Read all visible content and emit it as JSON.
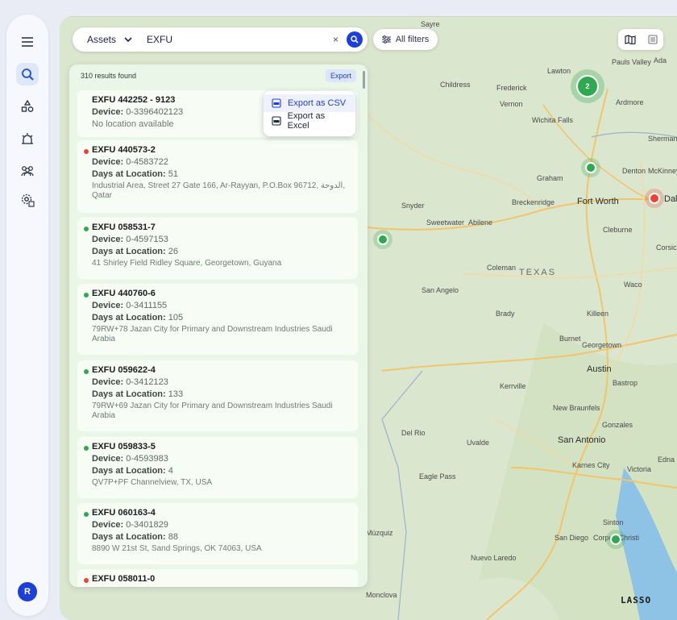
{
  "search": {
    "scope": "Assets",
    "query": "EXFU",
    "clear": "×"
  },
  "filters_label": "All filters",
  "results": {
    "count": "310 results found",
    "export_label": "Export",
    "export_menu": [
      "Export as CSV",
      "Export as Excel"
    ],
    "items": [
      {
        "id": "EXFU 442252 - 9123",
        "device": "0-3396402123",
        "days": "",
        "address": "No location available",
        "status": "none"
      },
      {
        "id": "EXFU 440573-2",
        "device": "0-4583722",
        "days": "51",
        "address": "Industrial Area, Street 27 Gate 166, Ar-Rayyan, P.O.Box 96712, الدوحة, Qatar",
        "status": "red"
      },
      {
        "id": "EXFU 058531-7",
        "device": "0-4597153",
        "days": "26",
        "address": "41 Shirley Field Ridley Square, Georgetown, Guyana",
        "status": "green"
      },
      {
        "id": "EXFU 440760-6",
        "device": "0-3411155",
        "days": "105",
        "address": "79RW+78 Jazan City for Primary and Downstream Industries Saudi Arabia",
        "status": "green"
      },
      {
        "id": "EXFU 059622-4",
        "device": "0-3412123",
        "days": "133",
        "address": "79RW+69 Jazan City for Primary and Downstream Industries Saudi Arabia",
        "status": "green"
      },
      {
        "id": "EXFU 059833-5",
        "device": "0-4593983",
        "days": "4",
        "address": "QV7P+PF Channelview, TX, USA",
        "status": "green"
      },
      {
        "id": "EXFU 060163-4",
        "device": "0-3401829",
        "days": "88",
        "address": "8890 W 21st St, Sand Springs, OK 74063, USA",
        "status": "green"
      },
      {
        "id": "EXFU 058011-0",
        "device": "",
        "days": "",
        "address": "",
        "status": "red"
      }
    ]
  },
  "labels": {
    "device": "Device: ",
    "days": "Days at Location: "
  },
  "user_initial": "R",
  "cluster_count": "2",
  "logo": "LASSO",
  "map_places": [
    "Sayre",
    "Pauls Valley",
    "Ada",
    "Lawton",
    "Childress",
    "Frederick",
    "Vernon",
    "Ardmore",
    "Wichita Falls",
    "Sherman",
    "Graham",
    "Denton",
    "McKinney",
    "Snyder",
    "Breckenridge",
    "Fort Worth",
    "Sweetwater",
    "Abilene",
    "Cleburne",
    "Corsicana",
    "Coleman",
    "TEXAS",
    "San Angelo",
    "Waco",
    "Brady",
    "Killeen",
    "Burnet",
    "Georgetown",
    "Austin",
    "Bastrop",
    "Kerrville",
    "New Braunfels",
    "Gonzales",
    "Del Rio",
    "Uvalde",
    "San Antonio",
    "Karnes City",
    "Victoria",
    "Edna",
    "Eagle Pass",
    "Sinton",
    "San Diego",
    "Corpus Christi",
    "Nuevo Laredo",
    "Múzquiz",
    "Monclova",
    "Dallas"
  ],
  "colors": {
    "accent": "#1e3fd6",
    "green": "#2fa84f",
    "red": "#ea4335"
  }
}
